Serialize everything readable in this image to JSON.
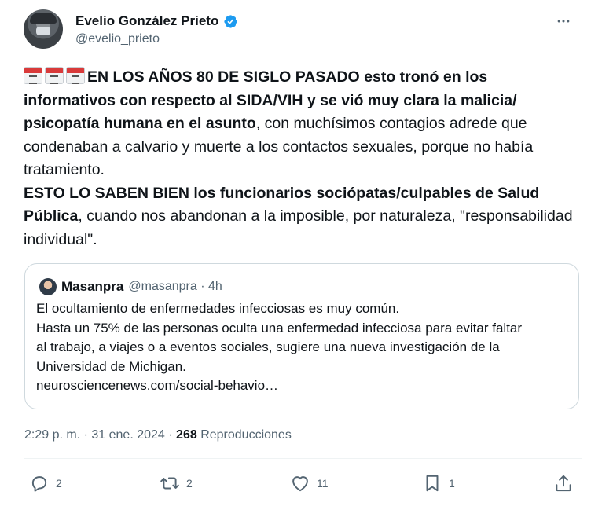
{
  "author": {
    "display_name": "Evelio González Prieto",
    "handle": "@evelio_prieto"
  },
  "post": {
    "part1_bold": "EN LOS AÑOS 80 DE SIGLO PASADO esto tronó en los informativos con respecto al SIDA/VIH y se vió muy clara la malicia/ psicopatía humana en el asunto",
    "part1_rest": ", con muchísimos contagios adrede que condenaban a  calvario y muerte a los contactos sexuales, porque no había tratamiento.",
    "part2_bold": "ESTO LO SABEN BIEN los funcionarios sociópatas/culpables de Salud Pública",
    "part2_rest": ", cuando nos abandonan a la imposible, por naturaleza, \"responsabilidad individual\"."
  },
  "quote": {
    "name": "Masanpra",
    "meta": "@masanpra · 4h",
    "lines": [
      "El ocultamiento de enfermedades infecciosas es muy común.",
      "Hasta un 75% de las personas oculta una enfermedad infecciosa para evitar faltar",
      "al trabajo, a viajes o a eventos sociales, sugiere una nueva investigación de la",
      "Universidad de Michigan.",
      "neurosciencenews.com/social-behavio…"
    ]
  },
  "meta": {
    "time": "2:29 p. m.",
    "sep": "·",
    "date": "31 ene. 2024",
    "views_count": "268",
    "views_label": "Reproducciones"
  },
  "actions": {
    "replies": "2",
    "reposts": "2",
    "likes": "11",
    "bookmarks": "1"
  },
  "icons": [
    "verified-badge-icon",
    "more-icon",
    "calendar-icon",
    "reply-icon",
    "repost-icon",
    "like-icon",
    "bookmark-icon",
    "share-icon"
  ],
  "colors": {
    "accent": "#1d9bf0",
    "text": "#0f1419",
    "secondary": "#536471",
    "border": "#cfd9de"
  }
}
